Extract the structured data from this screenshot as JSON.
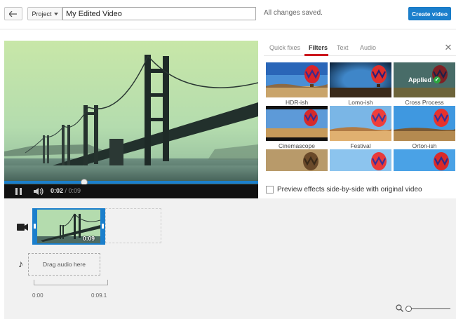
{
  "topbar": {
    "back_icon": "back-arrow-icon",
    "project_label": "Project",
    "title_value": "My Edited Video",
    "save_status": "All changes saved.",
    "create_label": "Create video"
  },
  "player": {
    "current_time": "0:02",
    "separator": " / ",
    "duration": "0:09",
    "progress_fraction": 0.31
  },
  "panel": {
    "tabs": [
      "Quick fixes",
      "Filters",
      "Text",
      "Audio"
    ],
    "active_tab": "Filters",
    "filters": [
      {
        "label": "HDR-ish"
      },
      {
        "label": "Lomo-ish"
      },
      {
        "label": "Cross Process",
        "applied_text": "Applied"
      },
      {
        "label": "Cinemascope"
      },
      {
        "label": "Festival"
      },
      {
        "label": "Orton-ish"
      },
      {
        "label": ""
      },
      {
        "label": ""
      },
      {
        "label": ""
      }
    ],
    "preview_label": "Preview effects side-by-side with original video"
  },
  "timeline": {
    "clip_duration": "0:09",
    "audio_placeholder": "Drag audio here",
    "tick_start": "0:00",
    "tick_end": "0:09.1"
  },
  "colors": {
    "accent": "#1b7fcc",
    "tab_underline": "#cc181e",
    "applied_check": "#2ba640"
  }
}
